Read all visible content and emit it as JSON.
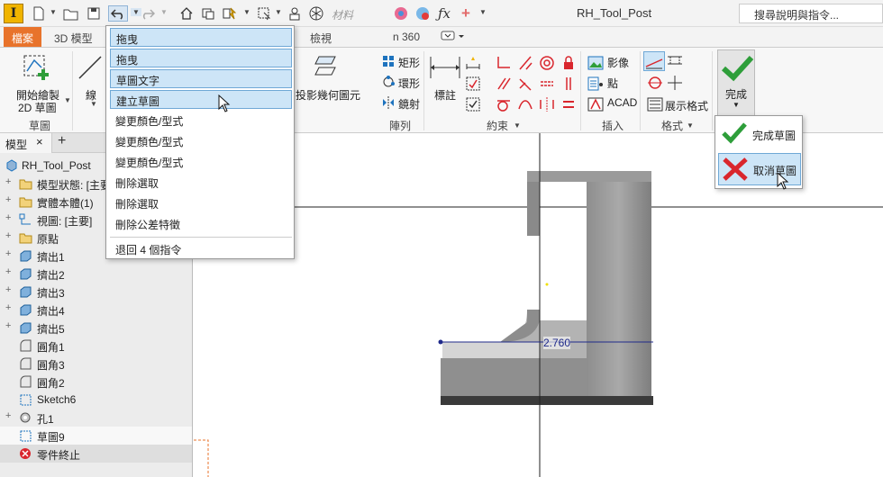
{
  "app": {
    "logo_letter": "I",
    "title": "RH_Tool_Post",
    "help_search_placeholder": "搜尋說明與指令...",
    "material_hint": "材料"
  },
  "ribbon_tabs": {
    "file": "檔案",
    "model3d": "3D 模型",
    "view": "檢視",
    "partial": "n 360"
  },
  "ribbon": {
    "start_sketch_line1": "開始繪製",
    "start_sketch_line2": "2D 草圖",
    "sketch_panel_title": "草圖",
    "line_label": "線",
    "project_geometry": "投影幾何圖元",
    "rectangle": "矩形",
    "ring": "環形",
    "mirror": "鏡射",
    "pattern_title": "陣列",
    "dimension": "標註",
    "constrain_title": "約束",
    "image": "影像",
    "point": "點",
    "acad": "ACAD",
    "insert_title": "插入",
    "show_format": "展示格式",
    "format_title": "格式",
    "finish_label": "完成"
  },
  "undo_menu": {
    "items": [
      {
        "label": "拖曳",
        "selected": true
      },
      {
        "label": "拖曳",
        "selected": true
      },
      {
        "label": "草圖文字",
        "selected": true
      },
      {
        "label": "建立草圖",
        "selected": true
      },
      {
        "label": "變更顏色/型式",
        "selected": false
      },
      {
        "label": "變更顏色/型式",
        "selected": false
      },
      {
        "label": "變更顏色/型式",
        "selected": false
      },
      {
        "label": "刪除選取",
        "selected": false
      },
      {
        "label": "刪除選取",
        "selected": false
      },
      {
        "label": "刪除公差特徵",
        "selected": false
      }
    ],
    "footer": "退回 4 個指令"
  },
  "finish_menu": {
    "finish_sketch": "完成草圖",
    "cancel_sketch": "取消草圖"
  },
  "browser": {
    "tab_label": "模型",
    "close_glyph": "×",
    "add_glyph": "+",
    "root": "RH_Tool_Post",
    "nodes": [
      {
        "label": "模型狀態: [主要]",
        "icon": "folder-icon",
        "expandable": true
      },
      {
        "label": "實體本體(1)",
        "icon": "folder-icon",
        "expandable": true
      },
      {
        "label": "視圖: [主要]",
        "icon": "view-icon",
        "expandable": true
      },
      {
        "label": "原點",
        "icon": "folder-icon",
        "expandable": true
      },
      {
        "label": "擠出1",
        "icon": "extrude-icon",
        "expandable": true
      },
      {
        "label": "擠出2",
        "icon": "extrude-icon",
        "expandable": true
      },
      {
        "label": "擠出3",
        "icon": "extrude-icon",
        "expandable": true
      },
      {
        "label": "擠出4",
        "icon": "extrude-icon",
        "expandable": true
      },
      {
        "label": "擠出5",
        "icon": "extrude-icon",
        "expandable": true
      },
      {
        "label": "圓角1",
        "icon": "fillet-icon",
        "expandable": false
      },
      {
        "label": "圓角3",
        "icon": "fillet-icon",
        "expandable": false
      },
      {
        "label": "圓角2",
        "icon": "fillet-icon",
        "expandable": false
      },
      {
        "label": "Sketch6",
        "icon": "sketch-icon",
        "expandable": false
      },
      {
        "label": "孔1",
        "icon": "hole-icon",
        "expandable": true
      },
      {
        "label": "草圖9",
        "icon": "sketch-icon",
        "expandable": false
      },
      {
        "label": "零件終止",
        "icon": "end-of-part-icon",
        "expandable": false
      }
    ]
  },
  "canvas": {
    "dimension_value": "2.760"
  },
  "colors": {
    "file_tab": "#e8732b",
    "accent_blue": "#1e73be",
    "check_green": "#2e9e3a",
    "cancel_red": "#d9262d",
    "selection_blue": "#cde5f7"
  }
}
